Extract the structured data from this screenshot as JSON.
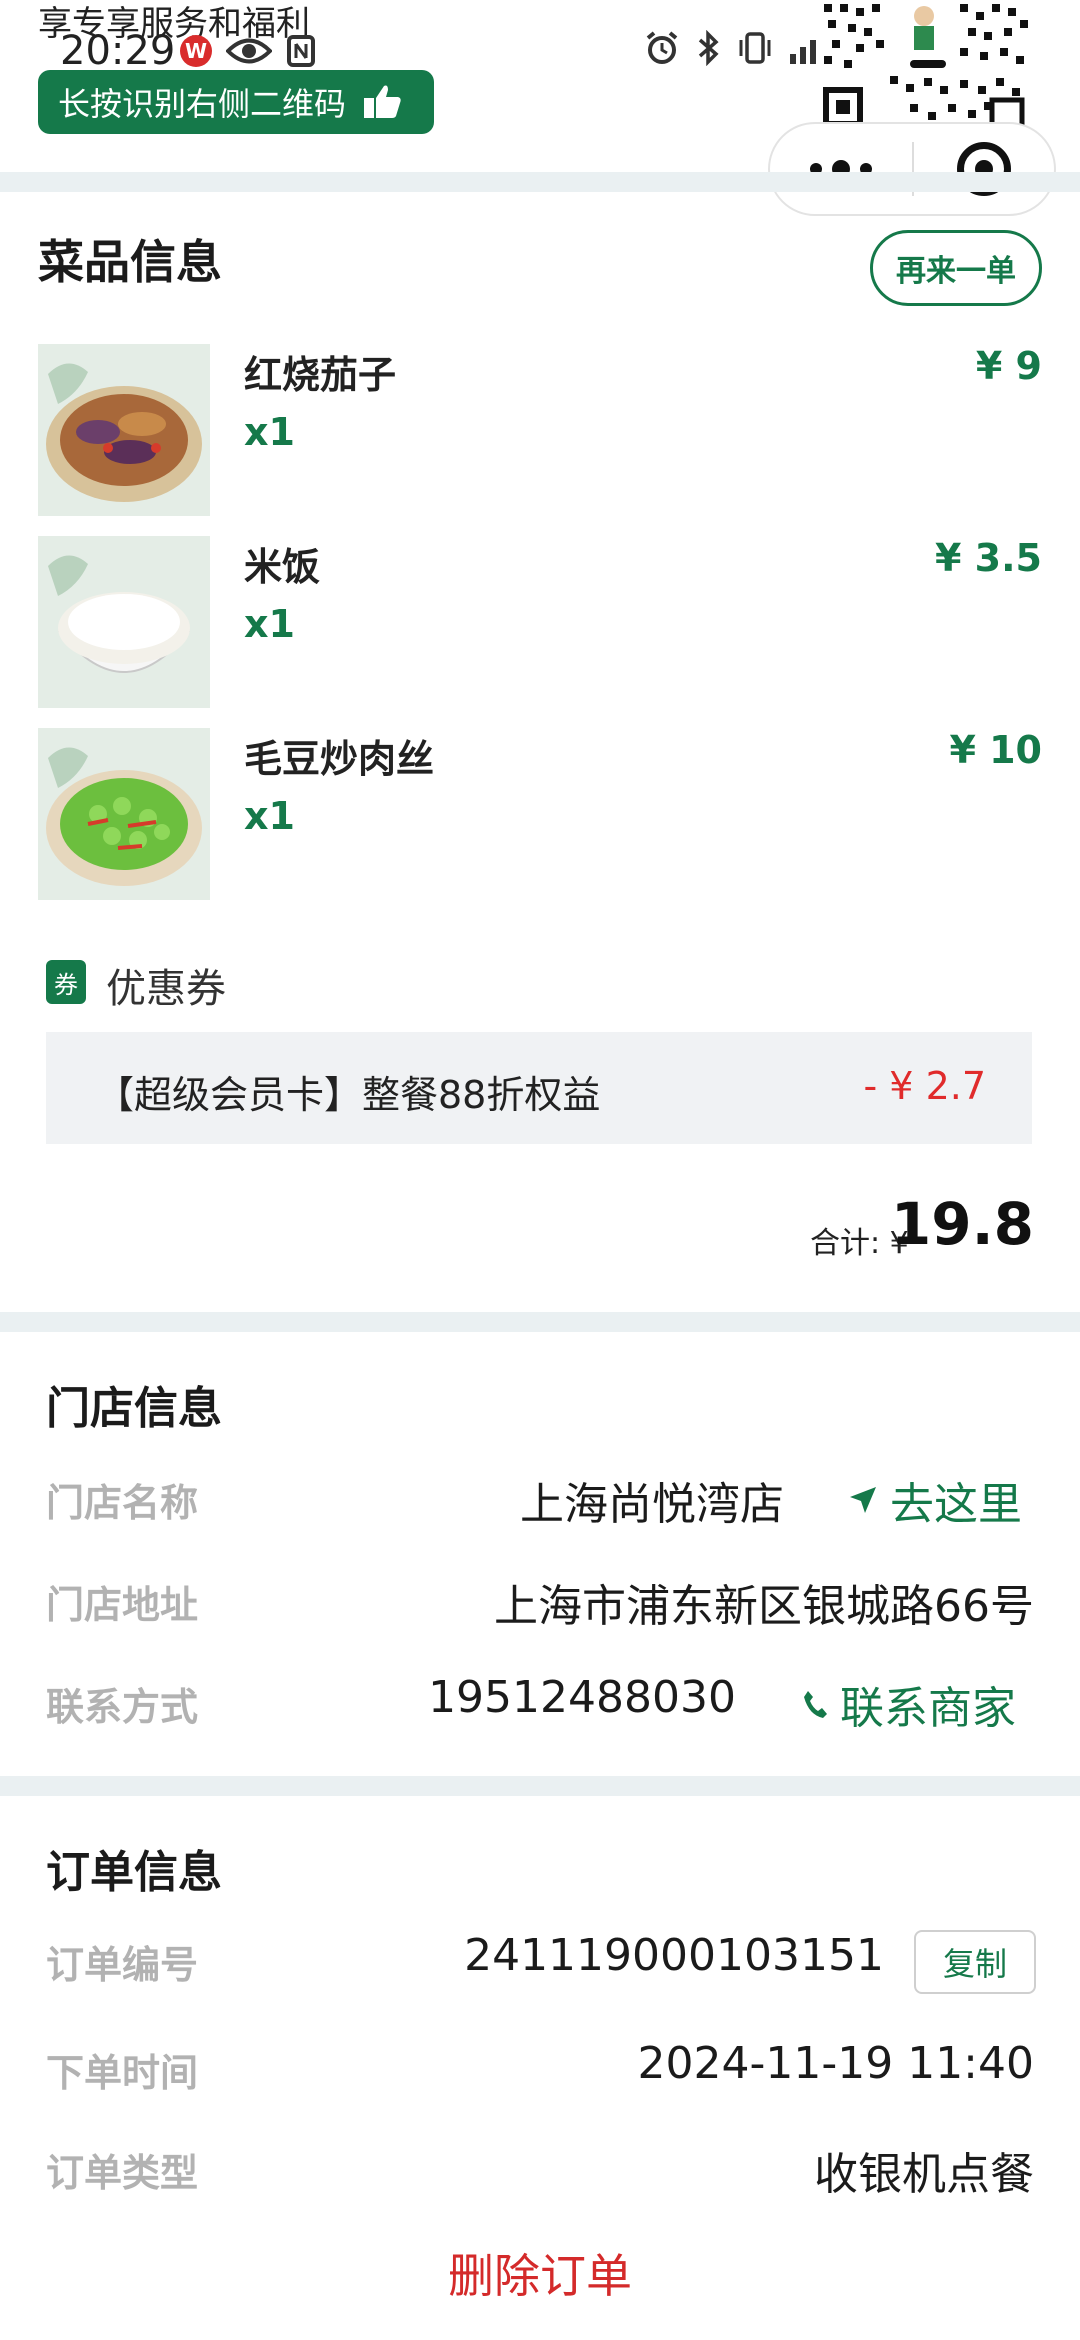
{
  "status_bar": {
    "banner_text": "享专享服务和福利",
    "time": "20:29",
    "w_badge": "W",
    "icons_left": [
      "weibo-icon",
      "eye-icon",
      "nfc-icon"
    ],
    "icons_right": [
      "alarm-icon",
      "bluetooth-icon",
      "vibrate-icon",
      "signal-icon",
      "battery-icon"
    ]
  },
  "promo": {
    "button_label": "长按识别右侧二维码"
  },
  "capsule": {
    "more_icon": "more-dots-icon",
    "close_icon": "target-close-icon"
  },
  "dishes_section": {
    "title": "菜品信息",
    "reorder_label": "再来一单",
    "items": [
      {
        "name": "红烧茄子",
        "qty": "x1",
        "price": "¥ 9"
      },
      {
        "name": "米饭",
        "qty": "x1",
        "price": "¥ 3.5"
      },
      {
        "name": "毛豆炒肉丝",
        "qty": "x1",
        "price": "¥ 10"
      }
    ],
    "coupon_tag": "券",
    "coupon_label": "优惠券",
    "coupon_text": "【超级会员卡】整餐88折权益",
    "coupon_discount": "- ¥ 2.7",
    "total_label": "合计: ¥",
    "total_value": "19.8"
  },
  "store_section": {
    "title": "门店信息",
    "name_label": "门店名称",
    "name_value": "上海尚悦湾店",
    "go_label": "去这里",
    "address_label": "门店地址",
    "address_value": "上海市浦东新区银城路66号",
    "contact_label": "联系方式",
    "contact_value": "19512488030",
    "call_label": "联系商家"
  },
  "order_section": {
    "title": "订单信息",
    "number_label": "订单编号",
    "number_value": "241119000103151",
    "copy_label": "复制",
    "time_label": "下单时间",
    "time_value": "2024-11-19 11:40",
    "type_label": "订单类型",
    "type_value": "收银机点餐",
    "delete_label": "删除订单"
  },
  "colors": {
    "brand_green": "#15794a",
    "discount_red": "#e02b2b",
    "delete_red": "#d42a2a",
    "section_gap": "#eaf0f2"
  }
}
